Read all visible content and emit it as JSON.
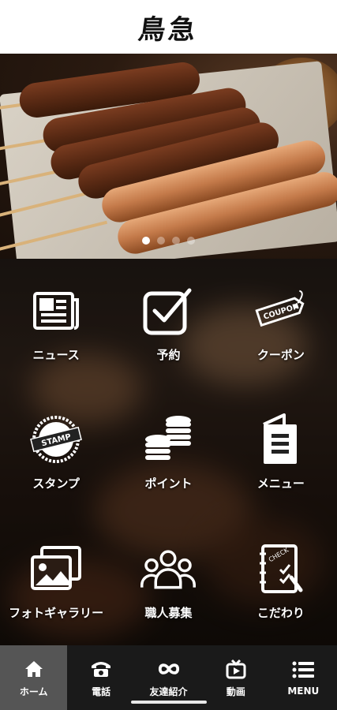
{
  "header": {
    "logo_text": "鳥急"
  },
  "hero": {
    "slide_count": 4,
    "active_index": 0
  },
  "menu": [
    {
      "label": "ニュース",
      "icon": "newspaper-icon"
    },
    {
      "label": "予約",
      "icon": "checkbox-icon"
    },
    {
      "label": "クーポン",
      "icon": "coupon-tag-icon",
      "icon_text": "COUPON"
    },
    {
      "label": "スタンプ",
      "icon": "stamp-icon",
      "icon_text": "STAMP"
    },
    {
      "label": "ポイント",
      "icon": "coins-icon"
    },
    {
      "label": "メニュー",
      "icon": "menu-book-icon"
    },
    {
      "label": "フォトギャラリー",
      "icon": "photo-gallery-icon"
    },
    {
      "label": "職人募集",
      "icon": "people-icon"
    },
    {
      "label": "こだわり",
      "icon": "checklist-icon",
      "icon_text": "CHECK"
    }
  ],
  "tabbar": [
    {
      "label": "ホーム",
      "icon": "home-icon",
      "active": true
    },
    {
      "label": "電話",
      "icon": "phone-icon",
      "active": false
    },
    {
      "label": "友達紹介",
      "icon": "infinity-icon",
      "active": false
    },
    {
      "label": "動画",
      "icon": "video-icon",
      "active": false
    },
    {
      "label": "MENU",
      "icon": "hamburger-icon",
      "active": false
    }
  ],
  "colors": {
    "tabbar_bg": "#1a1a1a",
    "tab_active_bg": "#555555",
    "header_bg": "#ffffff"
  }
}
